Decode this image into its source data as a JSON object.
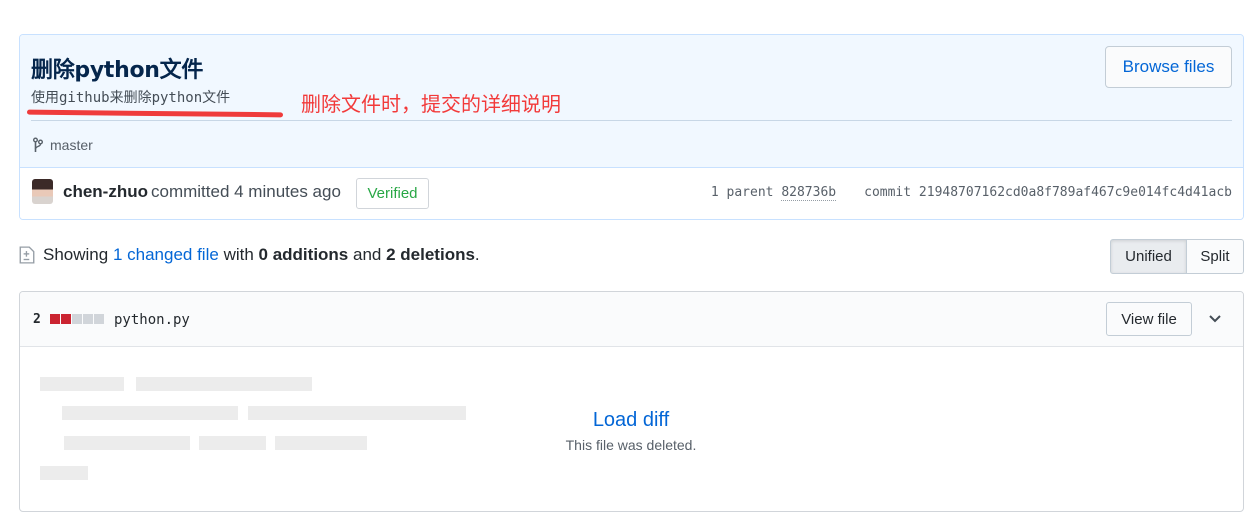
{
  "commit": {
    "title": "删除python文件",
    "description": "使用github来删除python文件",
    "annotation": "删除文件时，提交的详细说明",
    "browse_files_label": "Browse files",
    "branch": "master",
    "author": "chen-zhuo",
    "committed_text": "committed 4 minutes ago",
    "verified_label": "Verified",
    "parent_label": "1 parent",
    "parent_sha": "828736b",
    "commit_label": "commit",
    "commit_sha": "21948707162cd0a8f789af467c9e014fc4d41acb"
  },
  "toc": {
    "showing": "Showing",
    "changed_files": "1 changed file",
    "with": "with",
    "additions": "0 additions",
    "and": "and",
    "deletions": "2 deletions",
    "period": "."
  },
  "diff_view": {
    "unified_label": "Unified",
    "split_label": "Split",
    "selected": "Unified"
  },
  "file": {
    "change_count": "2",
    "diffstat": [
      "deleted",
      "deleted",
      "neutral",
      "neutral",
      "neutral"
    ],
    "name": "python.py",
    "view_file_label": "View file",
    "load_diff_label": "Load diff",
    "deleted_note": "This file was deleted."
  },
  "colors": {
    "link": "#0366d6",
    "verified": "#28a745",
    "annotation": "#f23a3a",
    "deleted_block": "#cb2431",
    "neutral_block": "#d1d5da"
  }
}
